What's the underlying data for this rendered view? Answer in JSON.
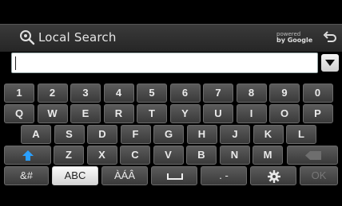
{
  "header": {
    "title": "Local Search",
    "powered_line1": "powered",
    "powered_line2": "by Google"
  },
  "search": {
    "value": "",
    "placeholder": ""
  },
  "keyboard": {
    "row1": [
      "1",
      "2",
      "3",
      "4",
      "5",
      "6",
      "7",
      "8",
      "9",
      "0"
    ],
    "row2": [
      "Q",
      "W",
      "E",
      "R",
      "T",
      "Y",
      "U",
      "I",
      "O",
      "P"
    ],
    "row3": [
      "A",
      "S",
      "D",
      "F",
      "G",
      "H",
      "J",
      "K",
      "L"
    ],
    "row4": [
      "Z",
      "X",
      "C",
      "V",
      "B",
      "N",
      "M"
    ],
    "symbols_label": "&#",
    "abc_label": "ABC",
    "accents_label": "ÀÁÂ",
    "punct_label": ". -",
    "ok_label": "OK",
    "icons": {
      "shift": "shift-arrow-icon",
      "backspace": "backspace-icon",
      "space": "space-bar-icon",
      "settings": "gear-icon"
    },
    "colors": {
      "shift": "#2aa0ff",
      "ok_disabled": "#777777"
    }
  }
}
